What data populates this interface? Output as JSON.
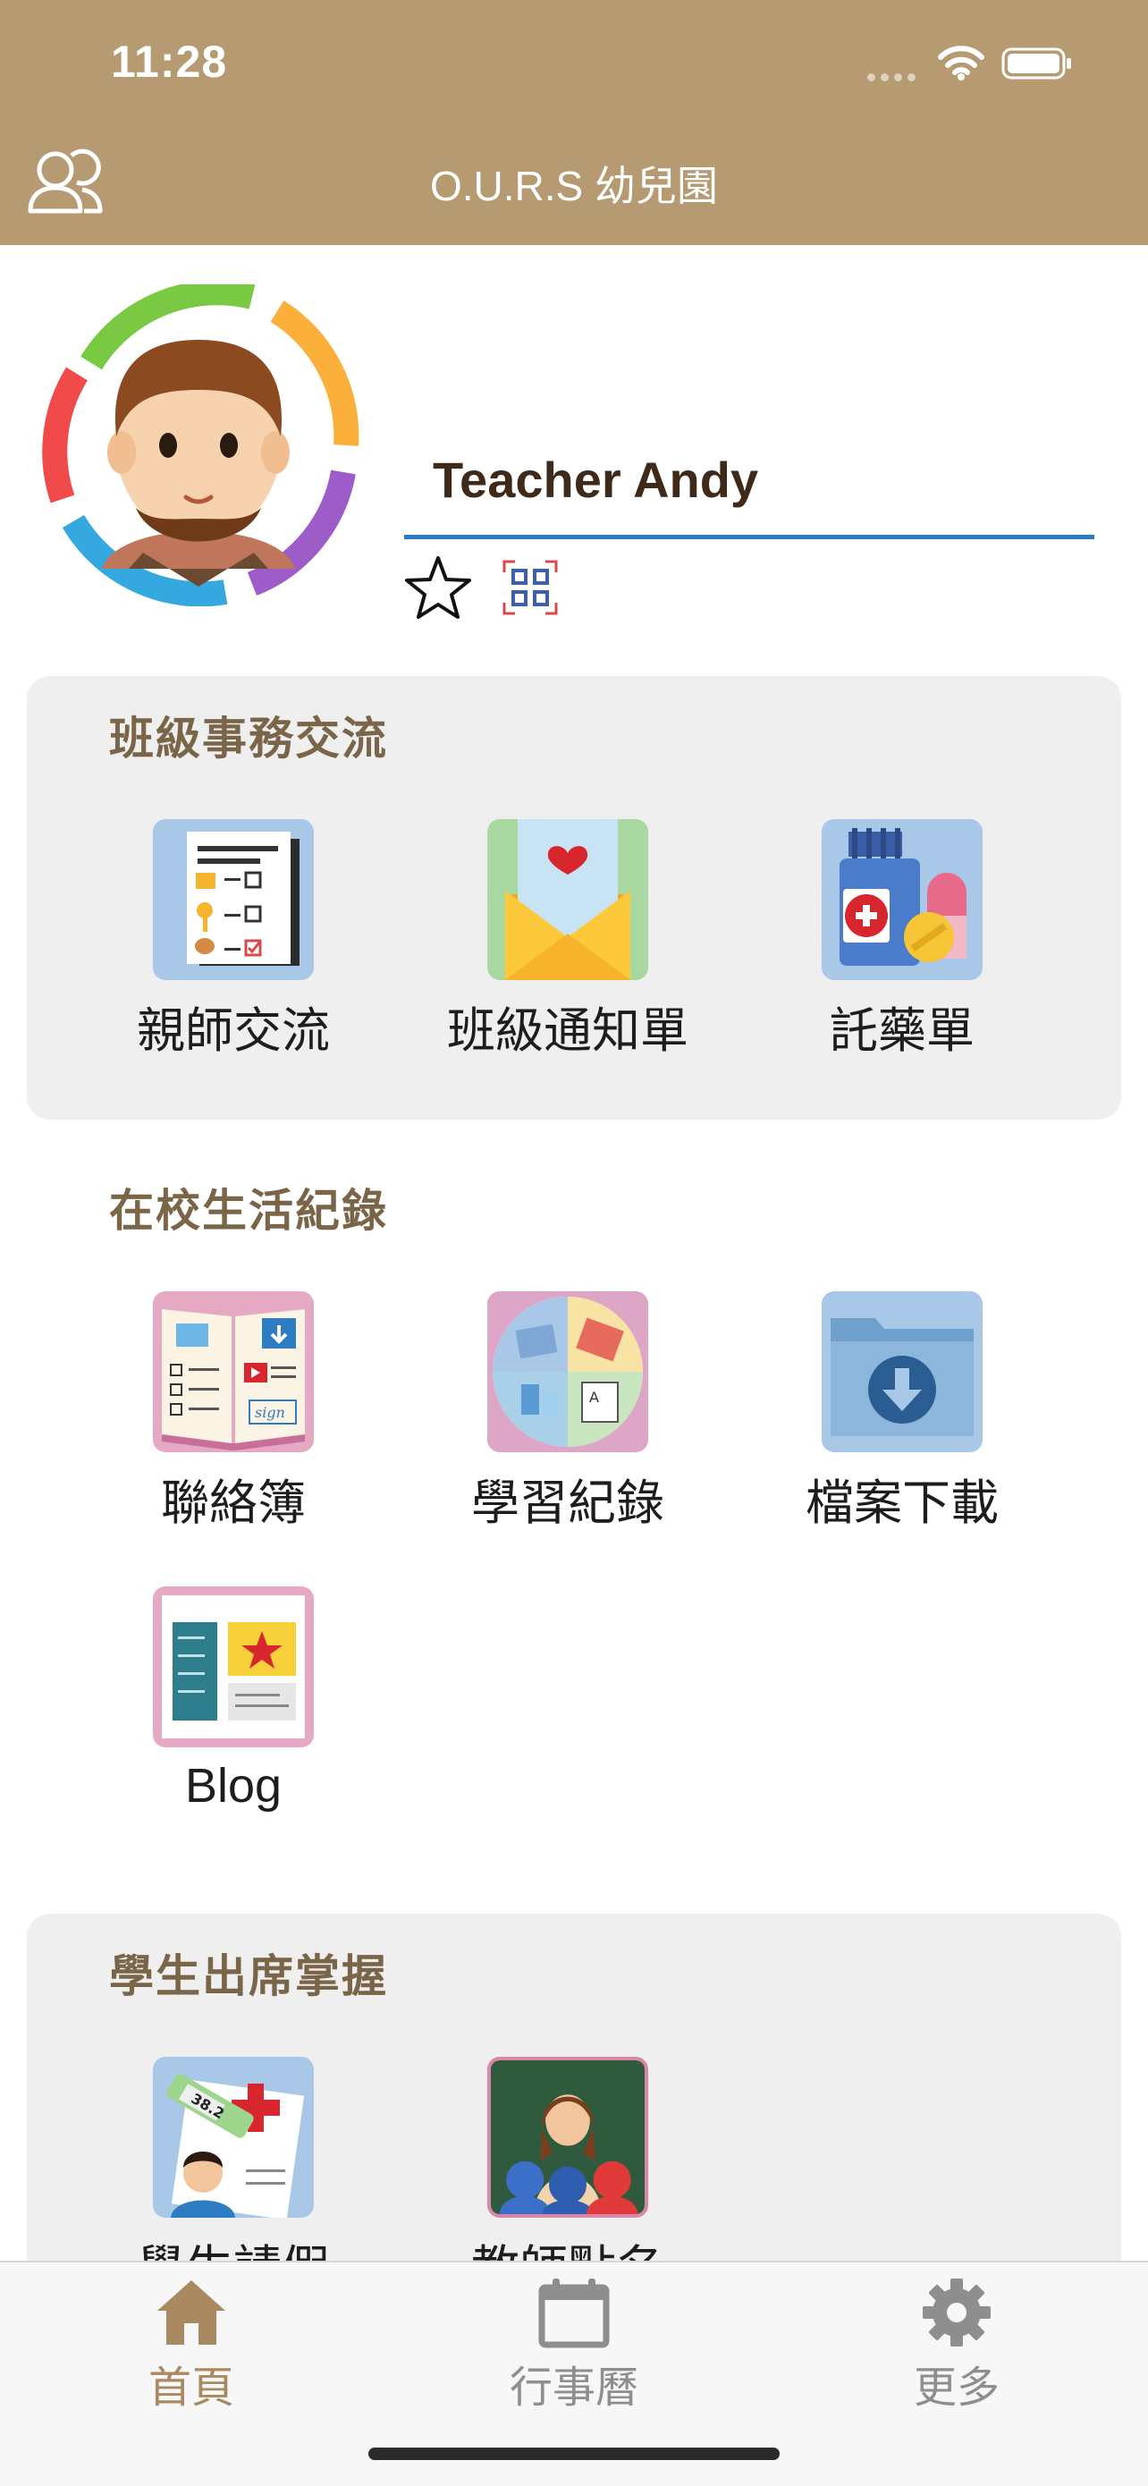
{
  "status_bar": {
    "time": "11:28"
  },
  "header": {
    "title": "O.U.R.S 幼兒園"
  },
  "profile": {
    "name": "Teacher Andy"
  },
  "sections": [
    {
      "title": "班級事務交流",
      "items": [
        {
          "label": "親師交流"
        },
        {
          "label": "班級通知單"
        },
        {
          "label": "託藥單"
        }
      ]
    },
    {
      "title": "在校生活紀錄",
      "items": [
        {
          "label": "聯絡簿"
        },
        {
          "label": "學習紀錄"
        },
        {
          "label": "檔案下載"
        },
        {
          "label": "Blog"
        }
      ]
    },
    {
      "title": "學生出席掌握",
      "items": [
        {
          "label": "學生請假"
        },
        {
          "label": "教師點名"
        }
      ]
    }
  ],
  "tabs": [
    {
      "label": "首頁",
      "icon": "house-icon",
      "active": true
    },
    {
      "label": "行事曆",
      "icon": "calendar-icon",
      "active": false
    },
    {
      "label": "更多",
      "icon": "gear-icon",
      "active": false
    }
  ],
  "colors": {
    "header": "#B59A72",
    "accent_active": "#A9895F",
    "inactive": "#8E8E8E",
    "panel": "#EFEFEF",
    "underline": "#2A7BC1"
  }
}
